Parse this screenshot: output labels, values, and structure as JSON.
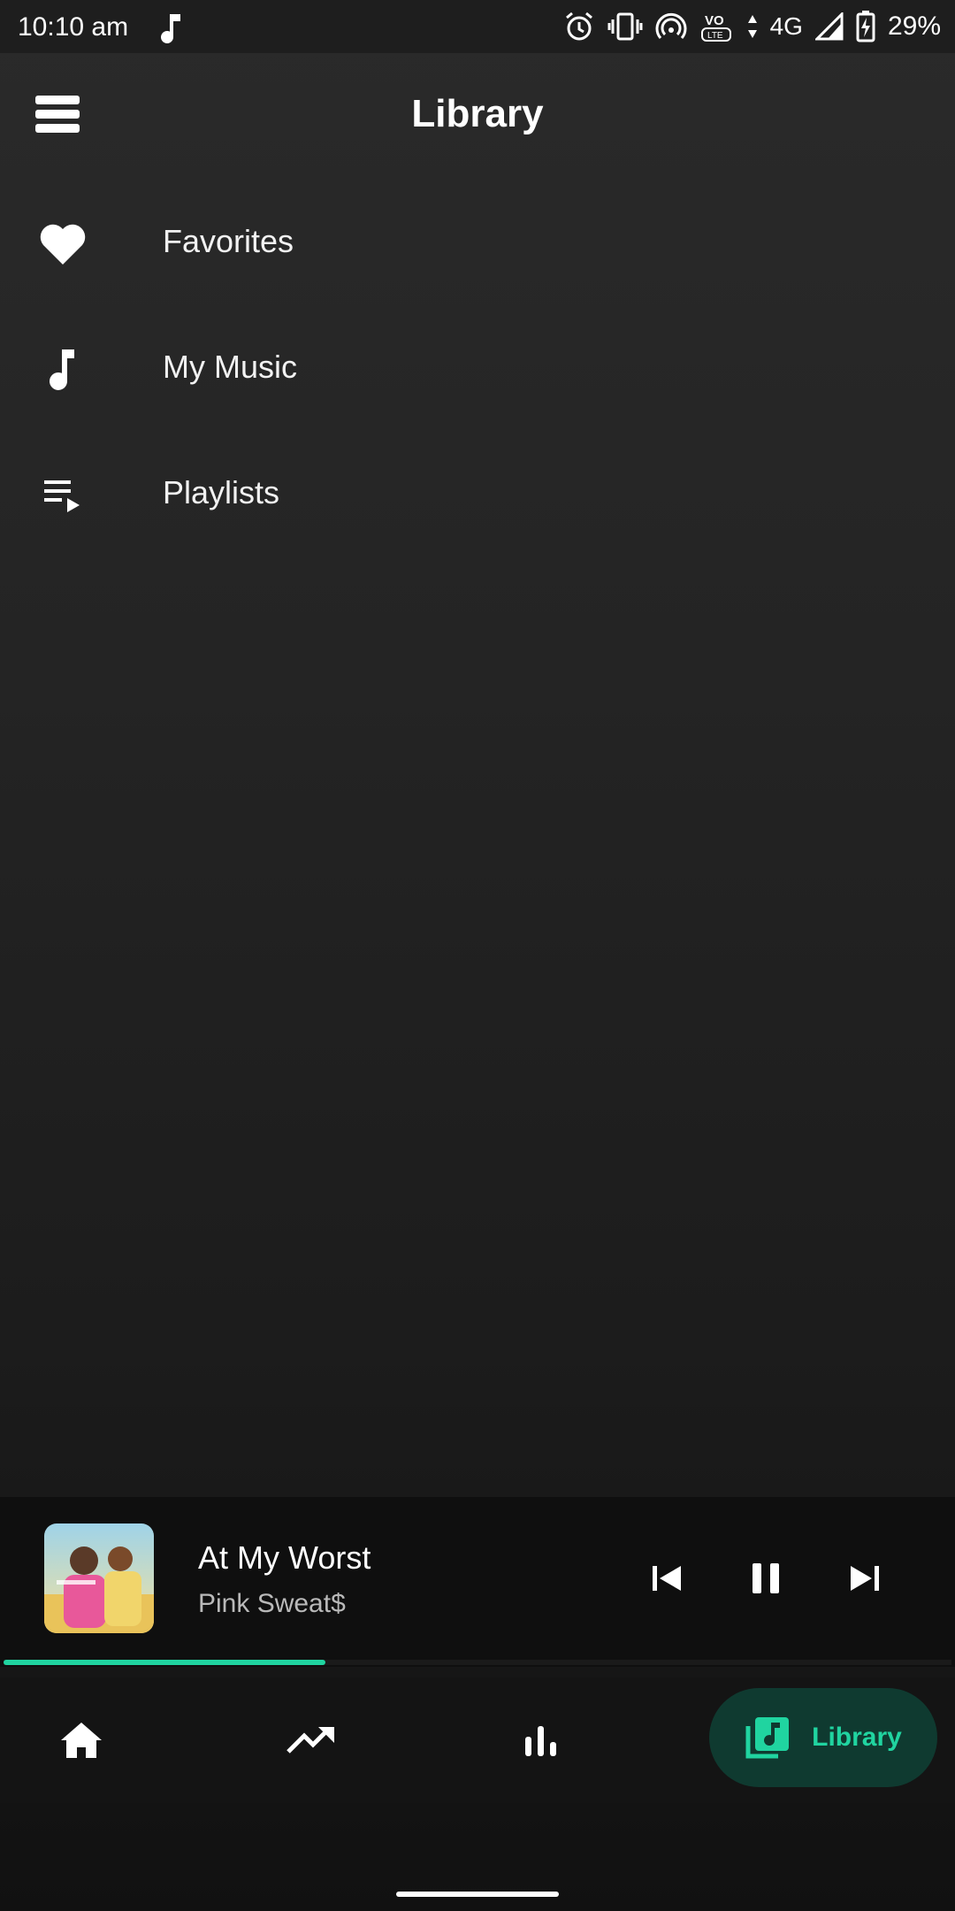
{
  "status_bar": {
    "time": "10:10 am",
    "network": "4G",
    "battery": "29%"
  },
  "header": {
    "title": "Library",
    "menu_icon": "menu-icon"
  },
  "library": {
    "items": [
      {
        "label": "Favorites",
        "icon": "heart-icon"
      },
      {
        "label": "My Music",
        "icon": "music-note-icon"
      },
      {
        "label": "Playlists",
        "icon": "playlist-icon"
      }
    ]
  },
  "player": {
    "title": "At My Worst",
    "artist": "Pink Sweat$",
    "progress": 0.34,
    "controls": [
      "skip-previous-icon",
      "pause-icon",
      "skip-next-icon"
    ]
  },
  "nav": {
    "items": [
      {
        "icon": "home-icon"
      },
      {
        "icon": "trending-icon"
      },
      {
        "icon": "charts-icon"
      },
      {
        "icon": "library-music-icon",
        "label": "Library",
        "active": true
      }
    ]
  },
  "colors": {
    "accent": "#20d4a0",
    "accent_pill_bg": "#0f3a30",
    "background": "#242424"
  }
}
